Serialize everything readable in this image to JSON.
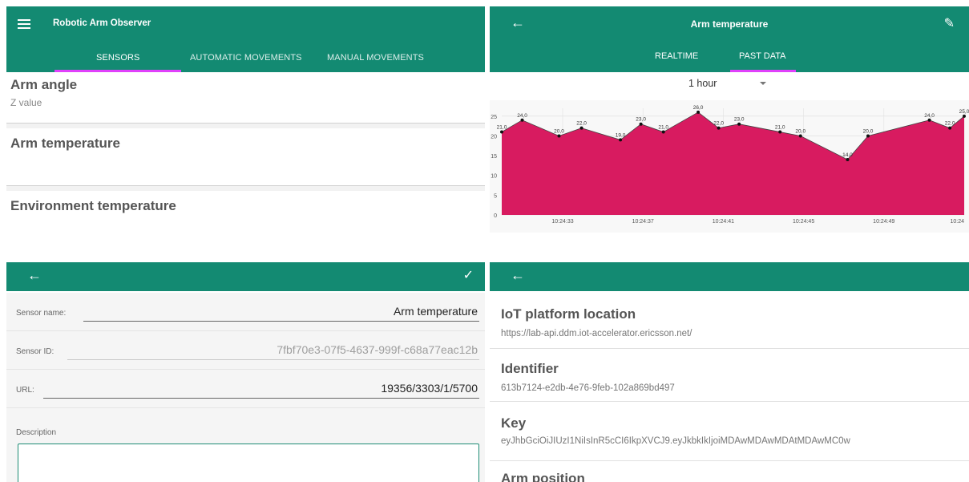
{
  "sensors_screen": {
    "app_title": "Robotic Arm Observer",
    "tabs": [
      "SENSORS",
      "AUTOMATIC MOVEMENTS",
      "MANUAL MOVEMENTS"
    ],
    "active_tab": "SENSORS",
    "sensors": [
      {
        "name": "Arm angle",
        "subtitle": "Z value"
      },
      {
        "name": "Arm temperature",
        "subtitle": ""
      },
      {
        "name": "Environment temperature",
        "subtitle": ""
      }
    ]
  },
  "detail_screen": {
    "title": "Arm temperature",
    "tabs": [
      "REALTIME",
      "PAST DATA"
    ],
    "active_tab": "PAST DATA",
    "range_select": "1 hour"
  },
  "chart_data": {
    "type": "area",
    "x_tick_labels": [
      "10:24:33",
      "10:24:37",
      "10:24:41",
      "10:24:45",
      "10:24:49",
      "10:24"
    ],
    "y_ticks": [
      0,
      5,
      10,
      15,
      20,
      25
    ],
    "ylim": [
      0,
      27
    ],
    "color": "#d81b60",
    "grid": true,
    "values": [
      21.0,
      24.0,
      20.0,
      22.0,
      19.0,
      23.0,
      21.0,
      26.0,
      22.0,
      23.0,
      21.0,
      20.0,
      14.0,
      20.0,
      24.0,
      22.0,
      25.0
    ],
    "labels": [
      "21,0",
      "24,0",
      "20,0",
      "22,0",
      "19,0",
      "23,0",
      "21,0",
      "26,0",
      "22,0",
      "23,0",
      "21,0",
      "20,0",
      "14,0",
      "20,0",
      "24,0",
      "22,0",
      "25,0"
    ],
    "x": [
      0.0,
      1.0,
      2.8,
      3.9,
      5.8,
      6.8,
      7.9,
      9.6,
      10.6,
      11.6,
      13.6,
      14.6,
      16.9,
      17.9,
      20.9,
      21.9,
      22.6
    ],
    "xlim": [
      0,
      22.6
    ]
  },
  "edit_screen": {
    "fields": [
      {
        "label": "Sensor name:",
        "value": "Arm temperature",
        "disabled": false
      },
      {
        "label": "Sensor ID:",
        "value": "7fbf70e3-07f5-4637-999f-c68a77eac12b",
        "disabled": true
      },
      {
        "label": "URL:",
        "value": "19356/3303/1/5700",
        "disabled": false
      }
    ],
    "description_label": "Description",
    "description_value": ""
  },
  "settings_screen": {
    "items": [
      {
        "title": "IoT platform location",
        "value": "https://lab-api.ddm.iot-accelerator.ericsson.net/"
      },
      {
        "title": "Identifier",
        "value": "613b7124-e2db-4e76-9feb-102a869bd497"
      },
      {
        "title": "Key",
        "value": "eyJhbGciOiJIUzI1NiIsInR5cCI6IkpXVCJ9.eyJkbkIkIjoiMDAwMDAwMDAtMDAwMC0w"
      },
      {
        "title": "Arm position",
        "value": ""
      }
    ]
  },
  "colors": {
    "primary": "#138a72",
    "accent": "#e040fb",
    "chart_fill": "#d81b60"
  },
  "icons": {
    "menu": "menu-icon",
    "back": "arrow-left-icon",
    "edit": "pencil-icon",
    "confirm": "check-icon",
    "dropdown": "caret-down-icon"
  }
}
